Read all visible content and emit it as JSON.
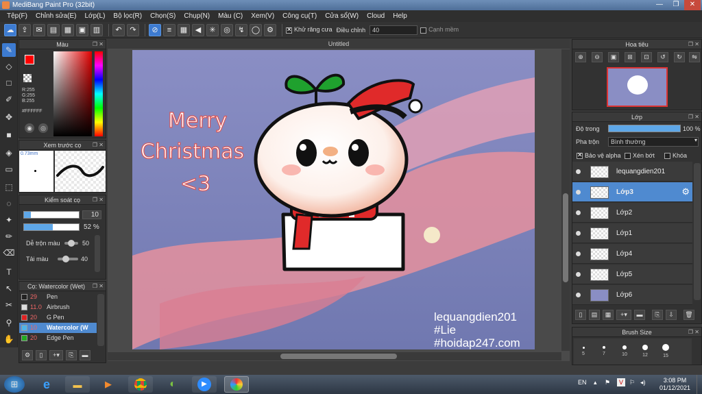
{
  "app": {
    "title": "MediBang Paint Pro (32bit)"
  },
  "menu": [
    "Tệp(F)",
    "Chỉnh sửa(E)",
    "Lớp(L)",
    "Bộ lọc(R)",
    "Chọn(S)",
    "Chụp(N)",
    "Màu (C)",
    "Xem(V)",
    "Công cụ(T)",
    "Cửa sổ(W)",
    "Cloud",
    "Help"
  ],
  "toolbar": {
    "antialias_label": "Khử răng cưa",
    "correction_label": "Điều chỉnh",
    "correction_value": "40",
    "sharp_edge_label": "Cạnh mềm"
  },
  "color_panel": {
    "title": "Màu",
    "r": "R:255",
    "g": "G:255",
    "b": "B:255",
    "hex": "#FFFFFF"
  },
  "preview_panel": {
    "title": "Xem trước cọ",
    "size": "0.73mm"
  },
  "brush_control": {
    "title": "Kiểm soát cọ",
    "size_value": "10",
    "opacity_value": "52 %",
    "blend_label": "Dễ trộn màu",
    "blend_value": "50",
    "load_label": "Tải màu",
    "load_value": "40",
    "size_fraction": 0.12,
    "opacity_fraction": 0.52,
    "blend_fraction": 0.5,
    "load_fraction": 0.4
  },
  "brush_list": {
    "title": "Cọ: Watercolor (Wet)",
    "items": [
      {
        "size": "29",
        "name": "Pen",
        "color": "#222222"
      },
      {
        "size": "11.0",
        "name": "Airbrush",
        "color": "#dddddd"
      },
      {
        "size": "20",
        "name": "G Pen",
        "color": "#dd2222"
      },
      {
        "size": "10",
        "name": "Watercolor (W",
        "color": "#4fb4e8"
      },
      {
        "size": "20",
        "name": "Edge Pen",
        "color": "#22aa22"
      }
    ]
  },
  "document": {
    "tab": "Untitled"
  },
  "artwork": {
    "greeting_line1": "Merry",
    "greeting_line2": "Christmas",
    "greeting_line3": "<3",
    "credit1": "lequangdien201",
    "credit2": "#Lie",
    "credit3": "#hoidap247.com"
  },
  "navigator": {
    "title": "Hoa tiêu"
  },
  "layer_panel": {
    "title": "Lớp",
    "opacity_label": "Độ trong",
    "opacity_value": "100 %",
    "opacity_fraction": 1.0,
    "blend_label": "Pha trộn",
    "blend_value": "Bình thường",
    "protect_alpha": "Bảo vệ alpha",
    "clipping": "Xén bớt",
    "lock": "Khóa",
    "layers": [
      {
        "name": "lequangdien201"
      },
      {
        "name": "Lớp3"
      },
      {
        "name": "Lớp2"
      },
      {
        "name": "Lớp1"
      },
      {
        "name": "Lớp4"
      },
      {
        "name": "Lớp5"
      },
      {
        "name": "Lớp6"
      }
    ]
  },
  "brush_size_panel": {
    "title": "Brush Size",
    "sizes": [
      "5",
      "7",
      "10",
      "12",
      "15"
    ]
  },
  "taskbar": {
    "language": "EN",
    "time": "3:08 PM",
    "date": "01/12/2021"
  },
  "colors": {
    "accent": "#3d7bd1",
    "foreground": "#ff0000",
    "background": "#ffffff"
  }
}
